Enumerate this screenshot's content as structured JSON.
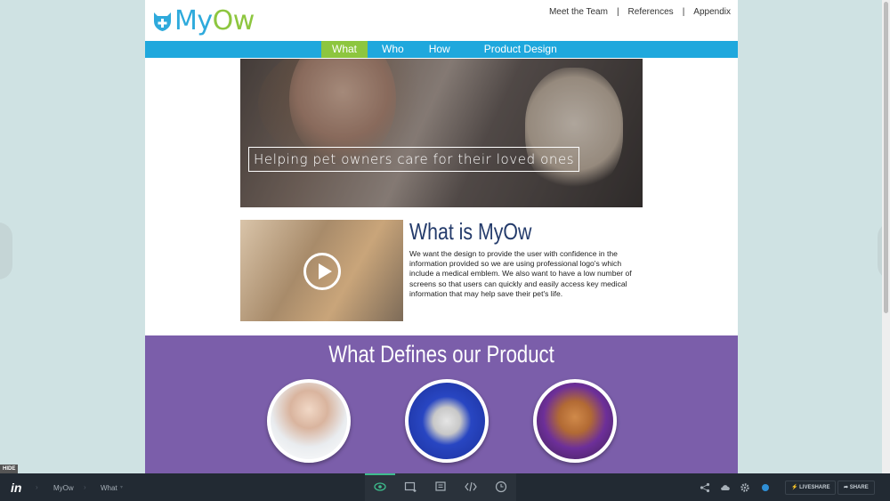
{
  "header": {
    "logo_prefix": "My",
    "logo_suffix": "Ow",
    "links": [
      "Meet the Team",
      "References",
      "Appendix"
    ],
    "separator": "|"
  },
  "nav": {
    "tabs": [
      "What",
      "Who",
      "How",
      "Product Design"
    ],
    "active": "What"
  },
  "hero": {
    "caption": "Helping pet owners care for their loved ones"
  },
  "what": {
    "title": "What is MyOw",
    "body": "We want the design to provide the user with confidence in the information provided so we are using professional logo's which include a medical emblem. We also want to have a low number of screens so that users can quickly and easily access key medical information that may help save their pet's life."
  },
  "defines": {
    "title": "What Defines our Product"
  },
  "toolbar": {
    "hide_label": "HIDE",
    "brand": "in",
    "breadcrumbs": [
      "MyOw",
      "What"
    ],
    "liveshare_label": "LIVESHARE",
    "share_label": "SHARE"
  },
  "colors": {
    "nav": "#1fa8dd",
    "nav_active": "#8dc63f",
    "purple_section": "#7b5eaa",
    "title_navy": "#243b6b"
  }
}
